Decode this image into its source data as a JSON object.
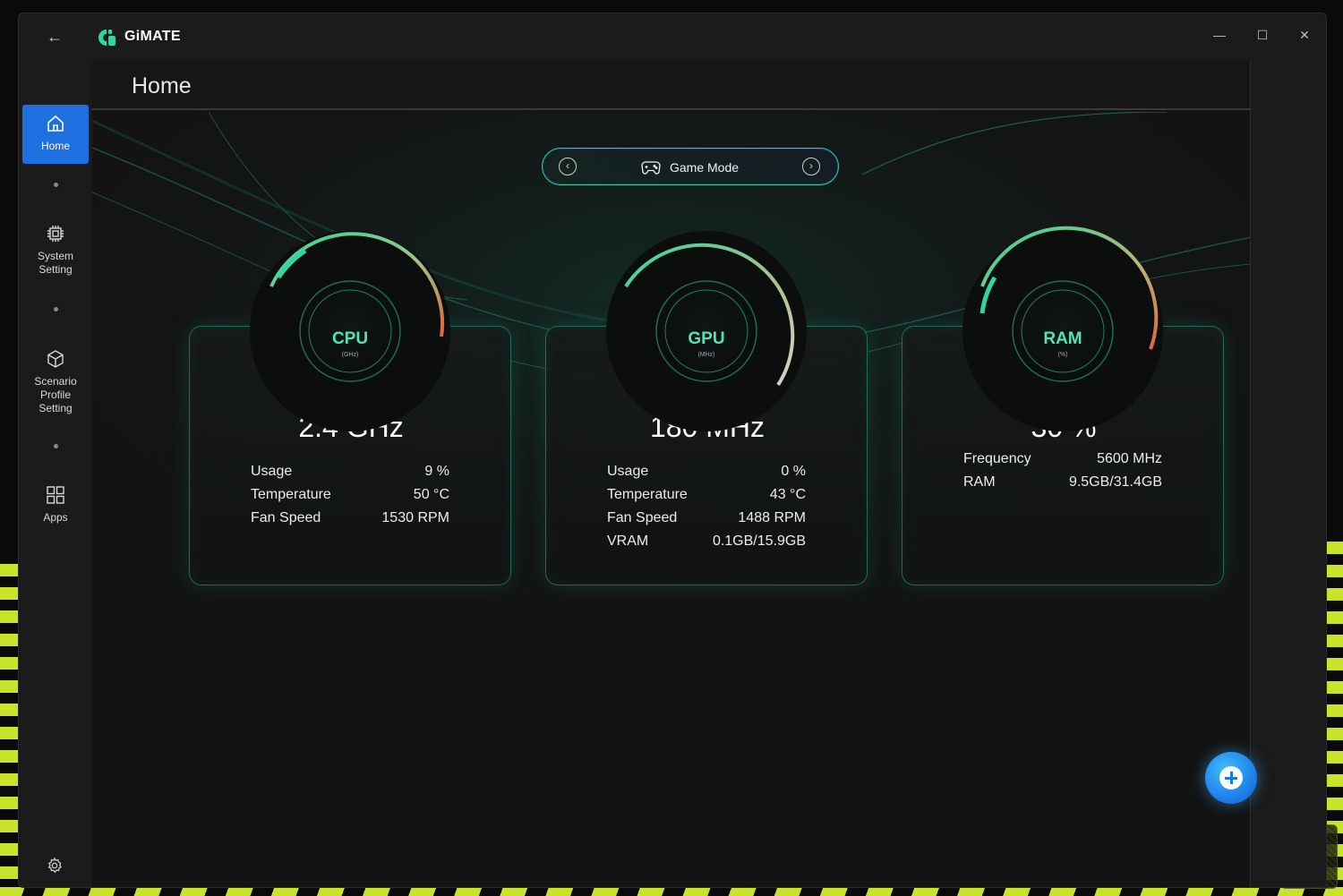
{
  "app": {
    "title": "GiMATE"
  },
  "window_controls": {
    "minimize": "—",
    "maximize": "☐",
    "close": "✕"
  },
  "sidebar": {
    "items": [
      {
        "label": "Home",
        "icon": "home-icon",
        "active": true
      },
      {
        "label": "System\nSetting",
        "icon": "chip-icon",
        "active": false
      },
      {
        "label": "Scenario\nProfile\nSetting",
        "icon": "cube-icon",
        "active": false
      },
      {
        "label": "Apps",
        "icon": "apps-grid-icon",
        "active": false
      }
    ],
    "settings_icon": "gear-icon"
  },
  "page": {
    "title": "Home"
  },
  "mode_selector": {
    "label": "Game Mode",
    "icon": "gamepad-icon"
  },
  "cards": [
    {
      "gauge_title": "CPU",
      "gauge_unit": "(GHz)",
      "value": "2.4 GHz",
      "stats": [
        {
          "key": "Usage",
          "value": "9 %"
        },
        {
          "key": "Temperature",
          "value": "50 °C"
        },
        {
          "key": "Fan Speed",
          "value": "1530 RPM"
        }
      ]
    },
    {
      "gauge_title": "GPU",
      "gauge_unit": "(MHz)",
      "value": "180 MHz",
      "stats": [
        {
          "key": "Usage",
          "value": "0 %"
        },
        {
          "key": "Temperature",
          "value": "43 °C"
        },
        {
          "key": "Fan Speed",
          "value": "1488 RPM"
        },
        {
          "key": "VRAM",
          "value": "0.1GB/15.9GB"
        }
      ]
    },
    {
      "gauge_title": "RAM",
      "gauge_unit": "(%)",
      "value": "30 %",
      "stats": [
        {
          "key": "Frequency",
          "value": "5600 MHz"
        },
        {
          "key": "RAM",
          "value": "9.5GB/31.4GB"
        }
      ]
    }
  ],
  "colors": {
    "accent_teal": "#2fc8a0",
    "active_nav": "#1e6fe0",
    "gauge_warm": "#e0673a"
  }
}
